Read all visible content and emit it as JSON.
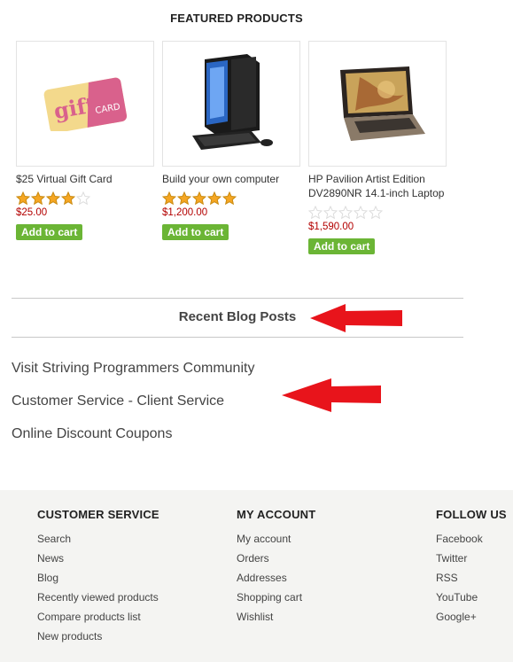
{
  "featured": {
    "title": "FEATURED PRODUCTS",
    "products": [
      {
        "name": "$25 Virtual Gift Card",
        "rating": 4,
        "max_rating": 5,
        "price": "$25.00",
        "button": "Add to cart",
        "image": "gift-card-image",
        "image_text_1": "gift",
        "image_text_2": "CARD"
      },
      {
        "name": "Build your own computer",
        "rating": 5,
        "max_rating": 5,
        "price": "$1,200.00",
        "button": "Add to cart",
        "image": "desktop-computer-image"
      },
      {
        "name": "HP Pavilion Artist Edition DV2890NR 14.1-inch Laptop",
        "rating": 0,
        "max_rating": 5,
        "price": "$1,590.00",
        "button": "Add to cart",
        "image": "laptop-image"
      }
    ]
  },
  "blog": {
    "title": "Recent Blog Posts",
    "posts": [
      "Visit Striving Programmers Community",
      "Customer Service - Client Service",
      "Online Discount Coupons"
    ]
  },
  "footer": {
    "customer_service": {
      "title": "CUSTOMER SERVICE",
      "links": [
        "Search",
        "News",
        "Blog",
        "Recently viewed products",
        "Compare products list",
        "New products"
      ]
    },
    "my_account": {
      "title": "MY ACCOUNT",
      "links": [
        "My account",
        "Orders",
        "Addresses",
        "Shopping cart",
        "Wishlist"
      ]
    },
    "follow_us": {
      "title": "FOLLOW US",
      "links": [
        "Facebook",
        "Twitter",
        "RSS",
        "YouTube",
        "Google+"
      ]
    }
  },
  "colors": {
    "star_filled": "#f5a623",
    "star_empty": "#dcdcdc",
    "price": "#b30000",
    "button": "#6bb535",
    "arrow": "#e8141b",
    "footer_bg": "#f4f4f2"
  }
}
